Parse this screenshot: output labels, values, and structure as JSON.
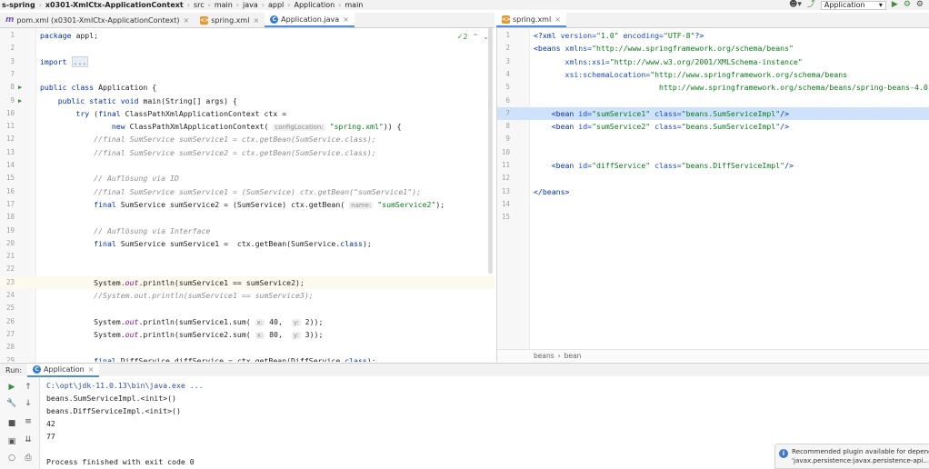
{
  "breadcrumbs": [
    "s-spring",
    "x0301-XmlCtx-ApplicationContext",
    "src",
    "main",
    "java",
    "appl",
    "Application",
    "main"
  ],
  "run_config": {
    "name": "Application"
  },
  "left_tabs": [
    {
      "label": "pom.xml (x0301-XmlCtx-ApplicationContext)",
      "icon": "maven-icon",
      "active": false
    },
    {
      "label": "spring.xml",
      "icon": "xml-file-icon",
      "active": false
    },
    {
      "label": "Application.java",
      "icon": "java-class-icon",
      "active": true
    }
  ],
  "right_tabs": [
    {
      "label": "spring.xml",
      "icon": "xml-file-icon",
      "active": true
    }
  ],
  "inspection": {
    "count": "2"
  },
  "java_lines": [
    {
      "n": "1",
      "parts": [
        [
          "kw",
          "package "
        ],
        [
          "",
          "appl;"
        ]
      ]
    },
    {
      "n": "2",
      "parts": []
    },
    {
      "n": "3",
      "parts": [
        [
          "kw",
          "import "
        ],
        [
          "fold",
          "..."
        ]
      ]
    },
    {
      "n": "7",
      "parts": []
    },
    {
      "n": "8",
      "run": true,
      "parts": [
        [
          "kw",
          "public class "
        ],
        [
          "",
          "Application {"
        ]
      ]
    },
    {
      "n": "9",
      "run": true,
      "parts": [
        [
          "",
          "    "
        ],
        [
          "kw",
          "public static void "
        ],
        [
          "",
          "main(String[] args) {"
        ]
      ]
    },
    {
      "n": "10",
      "parts": [
        [
          "",
          "        "
        ],
        [
          "kw",
          "try "
        ],
        [
          "",
          "("
        ],
        [
          "kw",
          "final "
        ],
        [
          "",
          "ClassPathXmlApplicationContext ctx ="
        ]
      ]
    },
    {
      "n": "11",
      "parts": [
        [
          "",
          "                "
        ],
        [
          "kw",
          "new "
        ],
        [
          "",
          "ClassPathXmlApplicationContext( "
        ],
        [
          "hint",
          "configLocation:"
        ],
        [
          "str",
          " \"spring.xml\""
        ],
        [
          "",
          ")) {"
        ]
      ]
    },
    {
      "n": "12",
      "parts": [
        [
          "",
          "            "
        ],
        [
          "cmt",
          "//final SumService sumService1 = ctx.getBean(SumService.class);"
        ]
      ]
    },
    {
      "n": "13",
      "parts": [
        [
          "",
          "            "
        ],
        [
          "cmt",
          "//final SumService sumService2 = ctx.getBean(SumService.class);"
        ]
      ]
    },
    {
      "n": "14",
      "parts": []
    },
    {
      "n": "15",
      "parts": [
        [
          "",
          "            "
        ],
        [
          "cmt",
          "// Auflösung via ID"
        ]
      ]
    },
    {
      "n": "16",
      "parts": [
        [
          "",
          "            "
        ],
        [
          "cmt",
          "//final SumService sumService1 = (SumService) ctx.getBean(\"sumService1\");"
        ]
      ]
    },
    {
      "n": "17",
      "parts": [
        [
          "",
          "            "
        ],
        [
          "kw",
          "final "
        ],
        [
          "",
          "SumService sumService2 = (SumService) ctx.getBean( "
        ],
        [
          "hint",
          "name:"
        ],
        [
          "str",
          " \"sumService2\""
        ],
        [
          "",
          ");"
        ]
      ]
    },
    {
      "n": "18",
      "parts": []
    },
    {
      "n": "19",
      "parts": [
        [
          "",
          "            "
        ],
        [
          "cmt",
          "// Auflösung via Interface"
        ]
      ]
    },
    {
      "n": "20",
      "parts": [
        [
          "",
          "            "
        ],
        [
          "kw",
          "final "
        ],
        [
          "",
          "SumService sumService1 =  ctx.getBean(SumService."
        ],
        [
          "kw",
          "class"
        ],
        [
          "",
          ");"
        ]
      ]
    },
    {
      "n": "21",
      "parts": []
    },
    {
      "n": "22",
      "parts": []
    },
    {
      "n": "23",
      "hl": true,
      "parts": [
        [
          "",
          "            System."
        ],
        [
          "fld",
          "out"
        ],
        [
          "",
          ".println(sumService1 == sumService2);"
        ]
      ]
    },
    {
      "n": "24",
      "parts": [
        [
          "",
          "            "
        ],
        [
          "cmt",
          "//System.out.println(sumService1 == sumService3);"
        ]
      ]
    },
    {
      "n": "25",
      "parts": []
    },
    {
      "n": "26",
      "parts": [
        [
          "",
          "            System."
        ],
        [
          "fld",
          "out"
        ],
        [
          "",
          ".println(sumService1.sum( "
        ],
        [
          "hint",
          "x:"
        ],
        [
          "",
          " 40,  "
        ],
        [
          "hint",
          "y:"
        ],
        [
          "",
          " 2));"
        ]
      ]
    },
    {
      "n": "27",
      "parts": [
        [
          "",
          "            System."
        ],
        [
          "fld",
          "out"
        ],
        [
          "",
          ".println(sumService2.sum( "
        ],
        [
          "hint",
          "x:"
        ],
        [
          "",
          " 80,  "
        ],
        [
          "hint",
          "y:"
        ],
        [
          "",
          " 3));"
        ]
      ]
    },
    {
      "n": "28",
      "parts": []
    },
    {
      "n": "29",
      "parts": [
        [
          "",
          "            "
        ],
        [
          "kw",
          "final "
        ],
        [
          "",
          "DiffService diffService = ctx.getBean(DiffService."
        ],
        [
          "kw",
          "class"
        ],
        [
          "",
          ");"
        ]
      ]
    }
  ],
  "xml_lines": [
    {
      "n": "1",
      "parts": [
        [
          "xtag",
          "<?xml "
        ],
        [
          "xattr",
          "version="
        ],
        [
          "xval",
          "\"1.0\" "
        ],
        [
          "xattr",
          "encoding="
        ],
        [
          "xval",
          "\"UTF-8\""
        ],
        [
          "xtag",
          "?>"
        ]
      ]
    },
    {
      "n": "2",
      "parts": [
        [
          "xtag",
          "<beans "
        ],
        [
          "xattr",
          "xmlns="
        ],
        [
          "xval",
          "\"http://www.springframework.org/schema/beans\""
        ]
      ]
    },
    {
      "n": "3",
      "parts": [
        [
          "",
          "       "
        ],
        [
          "xattr",
          "xmlns:xsi="
        ],
        [
          "xval",
          "\"http://www.w3.org/2001/XMLSchema-instance\""
        ]
      ]
    },
    {
      "n": "4",
      "parts": [
        [
          "",
          "       "
        ],
        [
          "xattr",
          "xsi:schemaLocation="
        ],
        [
          "xval",
          "\"http://www.springframework.org/schema/beans"
        ]
      ]
    },
    {
      "n": "5",
      "parts": [
        [
          "",
          "                    "
        ],
        [
          "xval",
          "        http://www.springframework.org/schema/beans/spring-beans-4.0.xsd\""
        ],
        [
          "xtag",
          ">"
        ]
      ]
    },
    {
      "n": "6",
      "parts": []
    },
    {
      "n": "7",
      "sel": true,
      "parts": [
        [
          "",
          "    "
        ],
        [
          "xtag",
          "<bean "
        ],
        [
          "xattr",
          "id="
        ],
        [
          "xval",
          "\"sumService1\" "
        ],
        [
          "xattr",
          "class="
        ],
        [
          "xval",
          "\"beans.SumServiceImpl\""
        ],
        [
          "xtag",
          "/>"
        ]
      ]
    },
    {
      "n": "8",
      "parts": [
        [
          "",
          "    "
        ],
        [
          "xtag",
          "<bean "
        ],
        [
          "xattr",
          "id="
        ],
        [
          "xval",
          "\"sumService2\" "
        ],
        [
          "xattr",
          "class="
        ],
        [
          "xval",
          "\"beans.SumServiceImpl\""
        ],
        [
          "xtag",
          "/>"
        ]
      ]
    },
    {
      "n": "9",
      "parts": []
    },
    {
      "n": "10",
      "parts": []
    },
    {
      "n": "11",
      "parts": [
        [
          "",
          "    "
        ],
        [
          "xtag",
          "<bean "
        ],
        [
          "xattr",
          "id="
        ],
        [
          "xval",
          "\"diffService\" "
        ],
        [
          "xattr",
          "class="
        ],
        [
          "xval",
          "\"beans.DiffServiceImpl\""
        ],
        [
          "xtag",
          "/>"
        ]
      ]
    },
    {
      "n": "12",
      "parts": []
    },
    {
      "n": "13",
      "parts": [
        [
          "xtag",
          "</beans>"
        ]
      ]
    },
    {
      "n": "14",
      "parts": []
    },
    {
      "n": "15",
      "parts": []
    }
  ],
  "xml_breadcrumb": [
    "beans",
    "bean"
  ],
  "run_panel": {
    "label": "Run:",
    "tab": "Application"
  },
  "console_lines": [
    {
      "text": "C:\\opt\\jdk-11.0.13\\bin\\java.exe ...",
      "cmd": true
    },
    {
      "text": "beans.SumServiceImpl.<init>()"
    },
    {
      "text": "beans.DiffServiceImpl.<init>()"
    },
    {
      "text": "42"
    },
    {
      "text": "77"
    },
    {
      "text": ""
    },
    {
      "text": "Process finished with exit code 0"
    }
  ],
  "notification": {
    "line1": "Recommended plugin available for dependen",
    "line2": "'javax.persistence:javax.persistence-api..."
  }
}
